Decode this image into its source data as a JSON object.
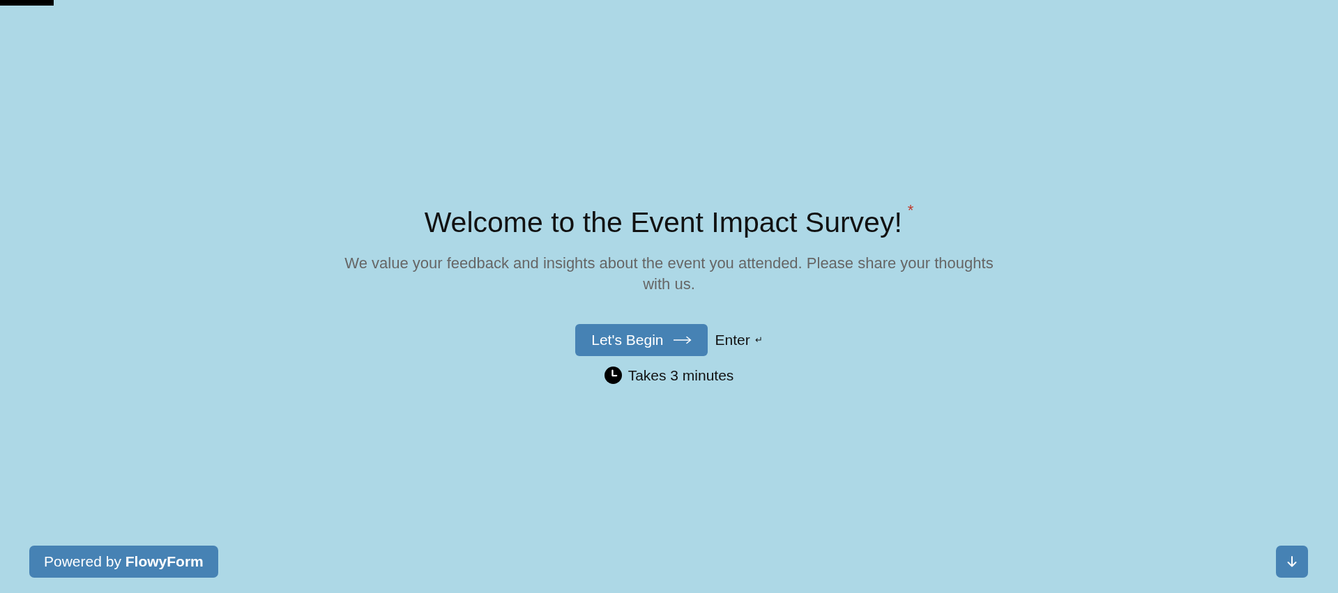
{
  "progress": {
    "level": 0.04
  },
  "welcome": {
    "title": "Welcome to the Event Impact Survey!",
    "required_mark": "*",
    "description": "We value your feedback and insights about the event you attended. Please share your thoughts with us.",
    "start_button": "Let's Begin",
    "key_hint": "Enter",
    "key_symbol": "↵",
    "duration": "Takes 3 minutes"
  },
  "footer": {
    "branding": "Powered by **FlowyForm**"
  }
}
